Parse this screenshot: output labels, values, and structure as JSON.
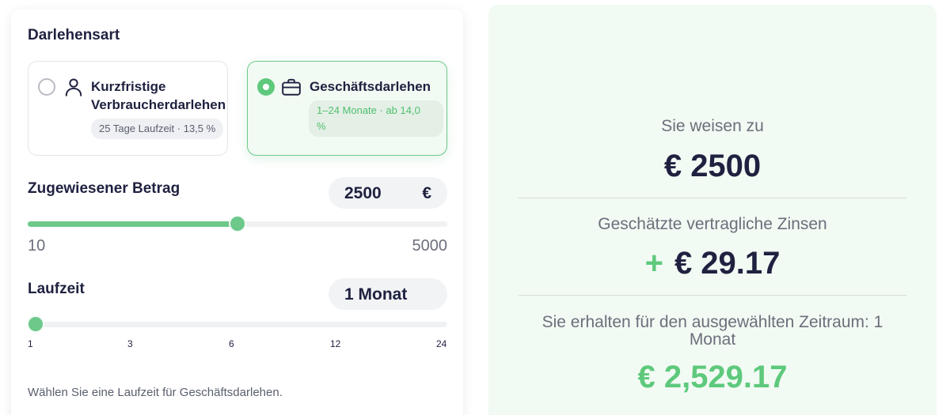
{
  "loan_type": {
    "title": "Darlehensart",
    "options": [
      {
        "title_line1": "Kurzfristige",
        "title_line2": "Verbraucherdarlehen",
        "badge": "25 Tage Laufzeit · 13,5 %",
        "icon": "person-icon",
        "selected": false
      },
      {
        "title_line1": "Geschäftsdarlehen",
        "badge_line1": "1–24 Monate · ab 14,0",
        "badge_line2": "%",
        "icon": "briefcase-icon",
        "selected": true
      }
    ]
  },
  "amount": {
    "label": "Zugewiesener Betrag",
    "value": "2500",
    "currency": "€",
    "min": "10",
    "max": "5000",
    "slider_fraction": 0.5
  },
  "term": {
    "label": "Laufzeit",
    "value": "1 Monat",
    "ticks": [
      "1",
      "3",
      "6",
      "12",
      "24"
    ],
    "selected_index": 0
  },
  "hint": "Wählen Sie eine Laufzeit für Geschäftsdarlehen.",
  "summary": {
    "assigned_label": "Sie weisen zu",
    "assigned_value": "€ 2500",
    "interest_label": "Geschätzte vertragliche Zinsen",
    "interest_prefix": "+",
    "interest_value": "€ 29.17",
    "receive_label_line1": "Sie erhalten für den ausgewählten Zeitraum: 1",
    "receive_label_line2": "Monat",
    "receive_value": "€ 2,529.17"
  },
  "colors": {
    "accent_green": "#5ec97c",
    "dark_text": "#1f2140",
    "summary_bg": "#f1faf3"
  }
}
